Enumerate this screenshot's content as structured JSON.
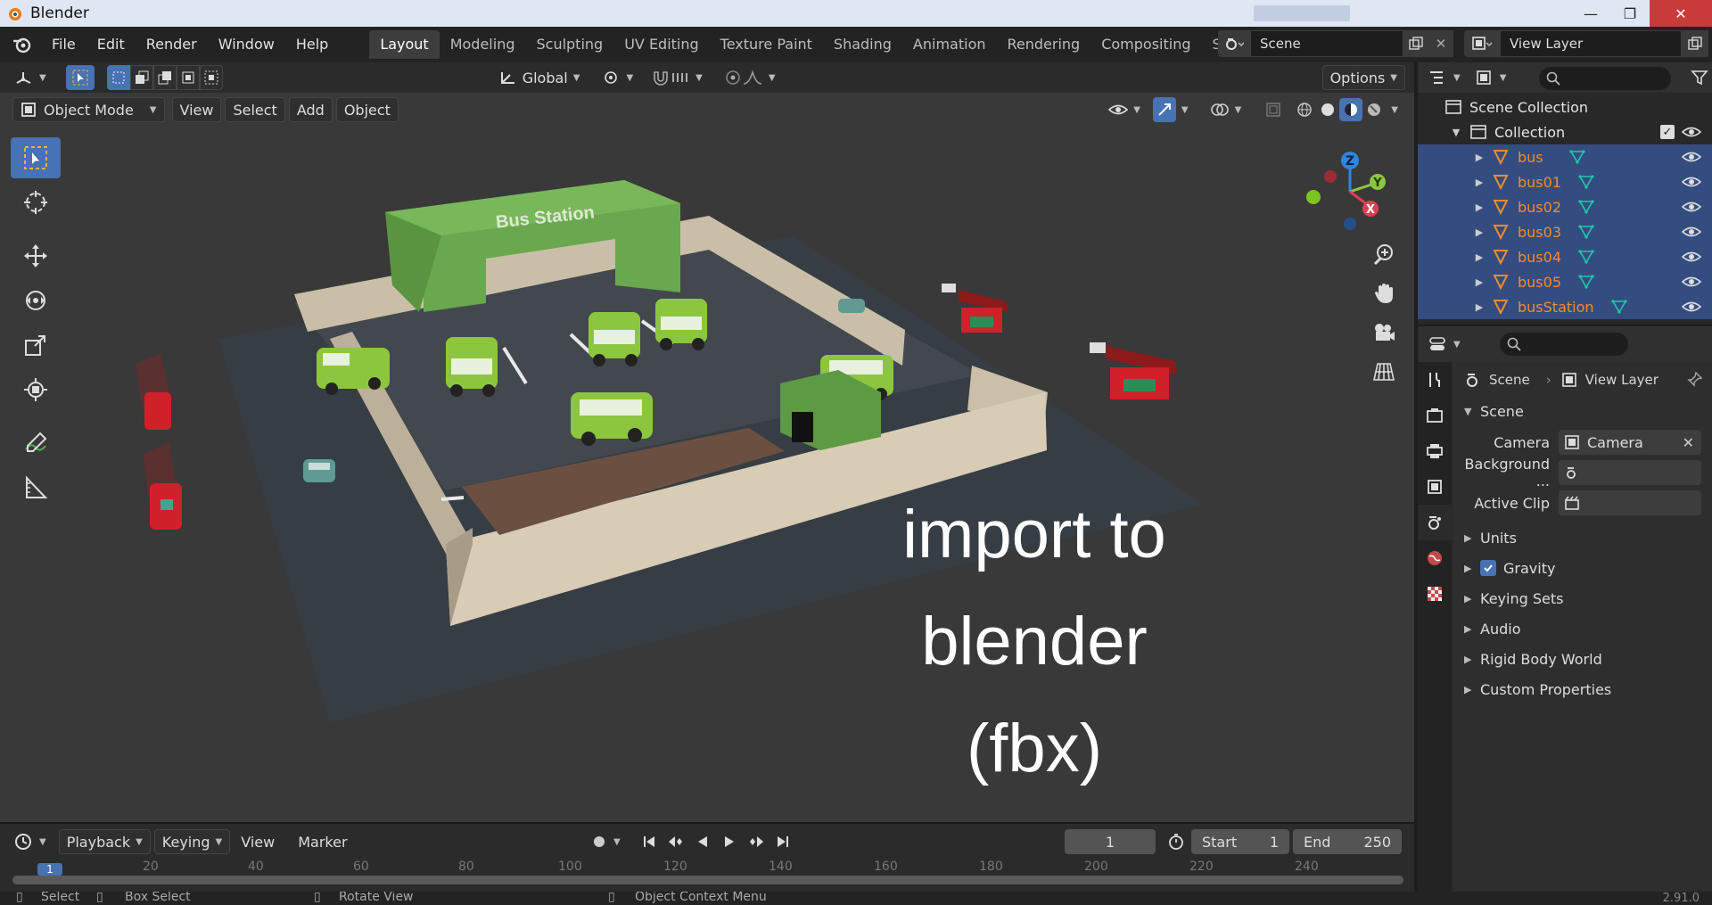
{
  "window": {
    "title": "Blender"
  },
  "menu": [
    "File",
    "Edit",
    "Render",
    "Window",
    "Help"
  ],
  "workspaces": [
    "Layout",
    "Modeling",
    "Sculpting",
    "UV Editing",
    "Texture Paint",
    "Shading",
    "Animation",
    "Rendering",
    "Compositing",
    "Scripting"
  ],
  "scene_name": "Scene",
  "view_layer_name": "View Layer",
  "viewport": {
    "mode": "Object Mode",
    "menus": [
      "View",
      "Select",
      "Add",
      "Object"
    ],
    "transform_orientation": "Global",
    "options_label": "Options",
    "sign_text": "Bus Station",
    "overlay_line1": "import to blender",
    "overlay_line2": "(fbx)",
    "gizmo": {
      "x": "X",
      "y": "Y",
      "z": "Z"
    }
  },
  "outliner": {
    "scene_collection": "Scene Collection",
    "collection": "Collection",
    "objects": [
      "bus",
      "bus01",
      "bus02",
      "bus03",
      "bus04",
      "bus05",
      "busStation"
    ]
  },
  "properties": {
    "tab_scene": "Scene",
    "tab_view_layer": "View Layer",
    "panel_scene": "Scene",
    "camera_label": "Camera",
    "camera_value": "Camera",
    "background_label": "Background ...",
    "active_clip_label": "Active Clip",
    "panels": [
      "Units",
      "Gravity",
      "Keying Sets",
      "Audio",
      "Rigid Body World",
      "Custom Properties"
    ]
  },
  "timeline": {
    "menus": [
      "Playback",
      "Keying",
      "View",
      "Marker"
    ],
    "current_frame": "1",
    "start_label": "Start",
    "start_value": "1",
    "end_label": "End",
    "end_value": "250",
    "ruler": [
      "1",
      "20",
      "40",
      "60",
      "80",
      "100",
      "120",
      "140",
      "160",
      "180",
      "200",
      "220",
      "240"
    ]
  },
  "statusbar": {
    "select": "Select",
    "box_select": "Box Select",
    "rotate_view": "Rotate View",
    "context_menu": "Object Context Menu",
    "version": "2.91.0"
  },
  "colors": {
    "accent": "#4772b3",
    "object_orange": "#f08b2f",
    "bus_green": "#8cc63f",
    "station_green": "#6aa84f"
  }
}
